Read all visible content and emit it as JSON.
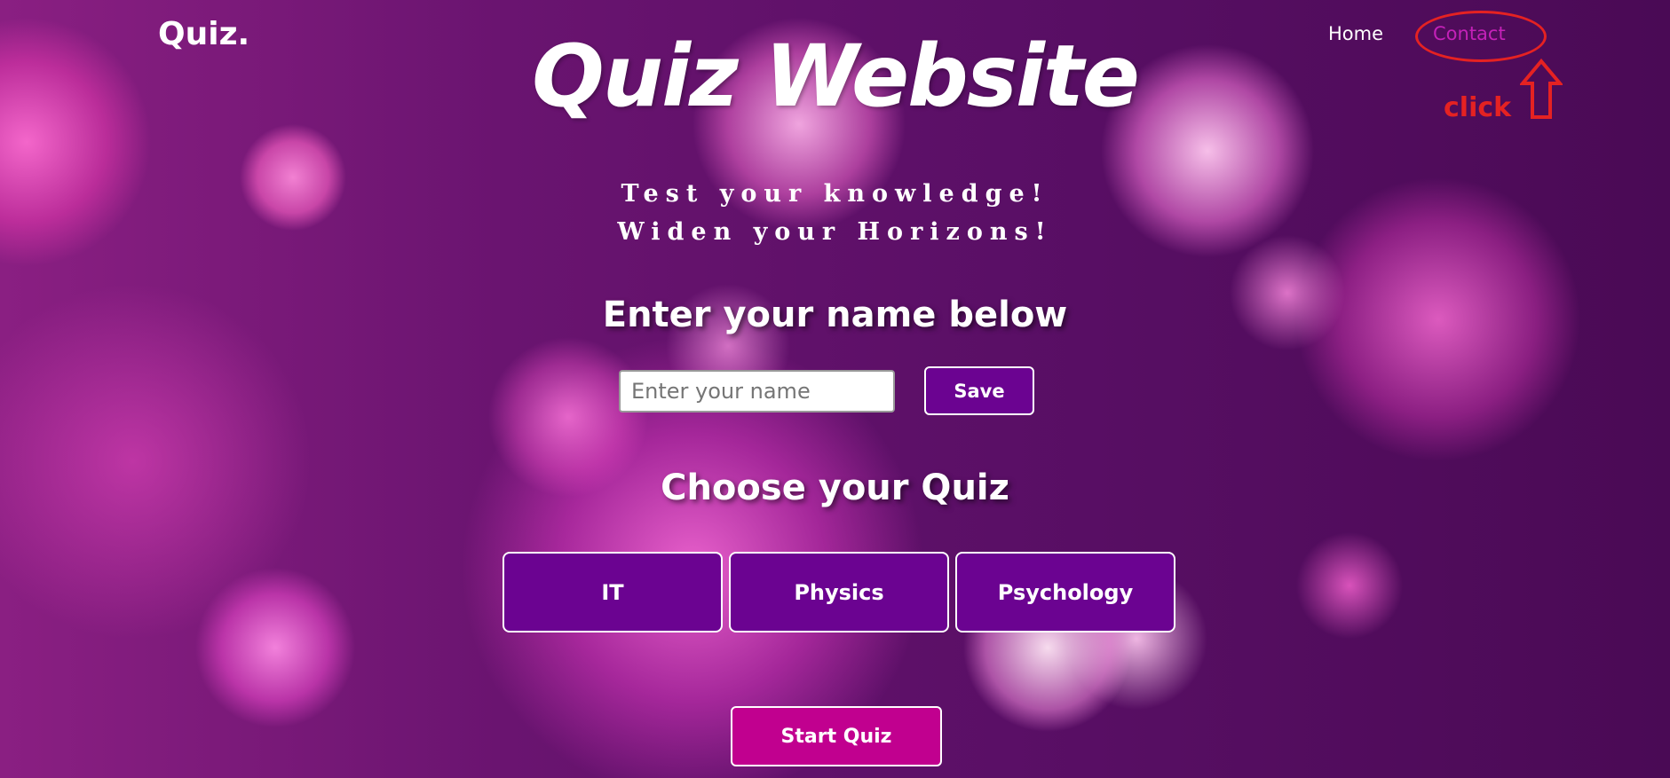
{
  "header": {
    "logo": "Quiz.",
    "nav": [
      {
        "label": "Home"
      },
      {
        "label": "Contact"
      }
    ]
  },
  "annotation": {
    "label": "click",
    "color": "#e52222"
  },
  "hero": {
    "title": "Quiz Website",
    "subtitle_line1": "Test your knowledge!",
    "subtitle_line2": "Widen your Horizons!"
  },
  "name_section": {
    "heading": "Enter your name below",
    "placeholder": "Enter your name",
    "save_label": "Save"
  },
  "quiz_section": {
    "heading": "Choose your Quiz",
    "options": [
      "IT",
      "Physics",
      "Psychology"
    ]
  },
  "start_label": "Start Quiz",
  "colors": {
    "button": "#6b0391",
    "start": "#c1008f",
    "active_nav": "#c421b8"
  }
}
